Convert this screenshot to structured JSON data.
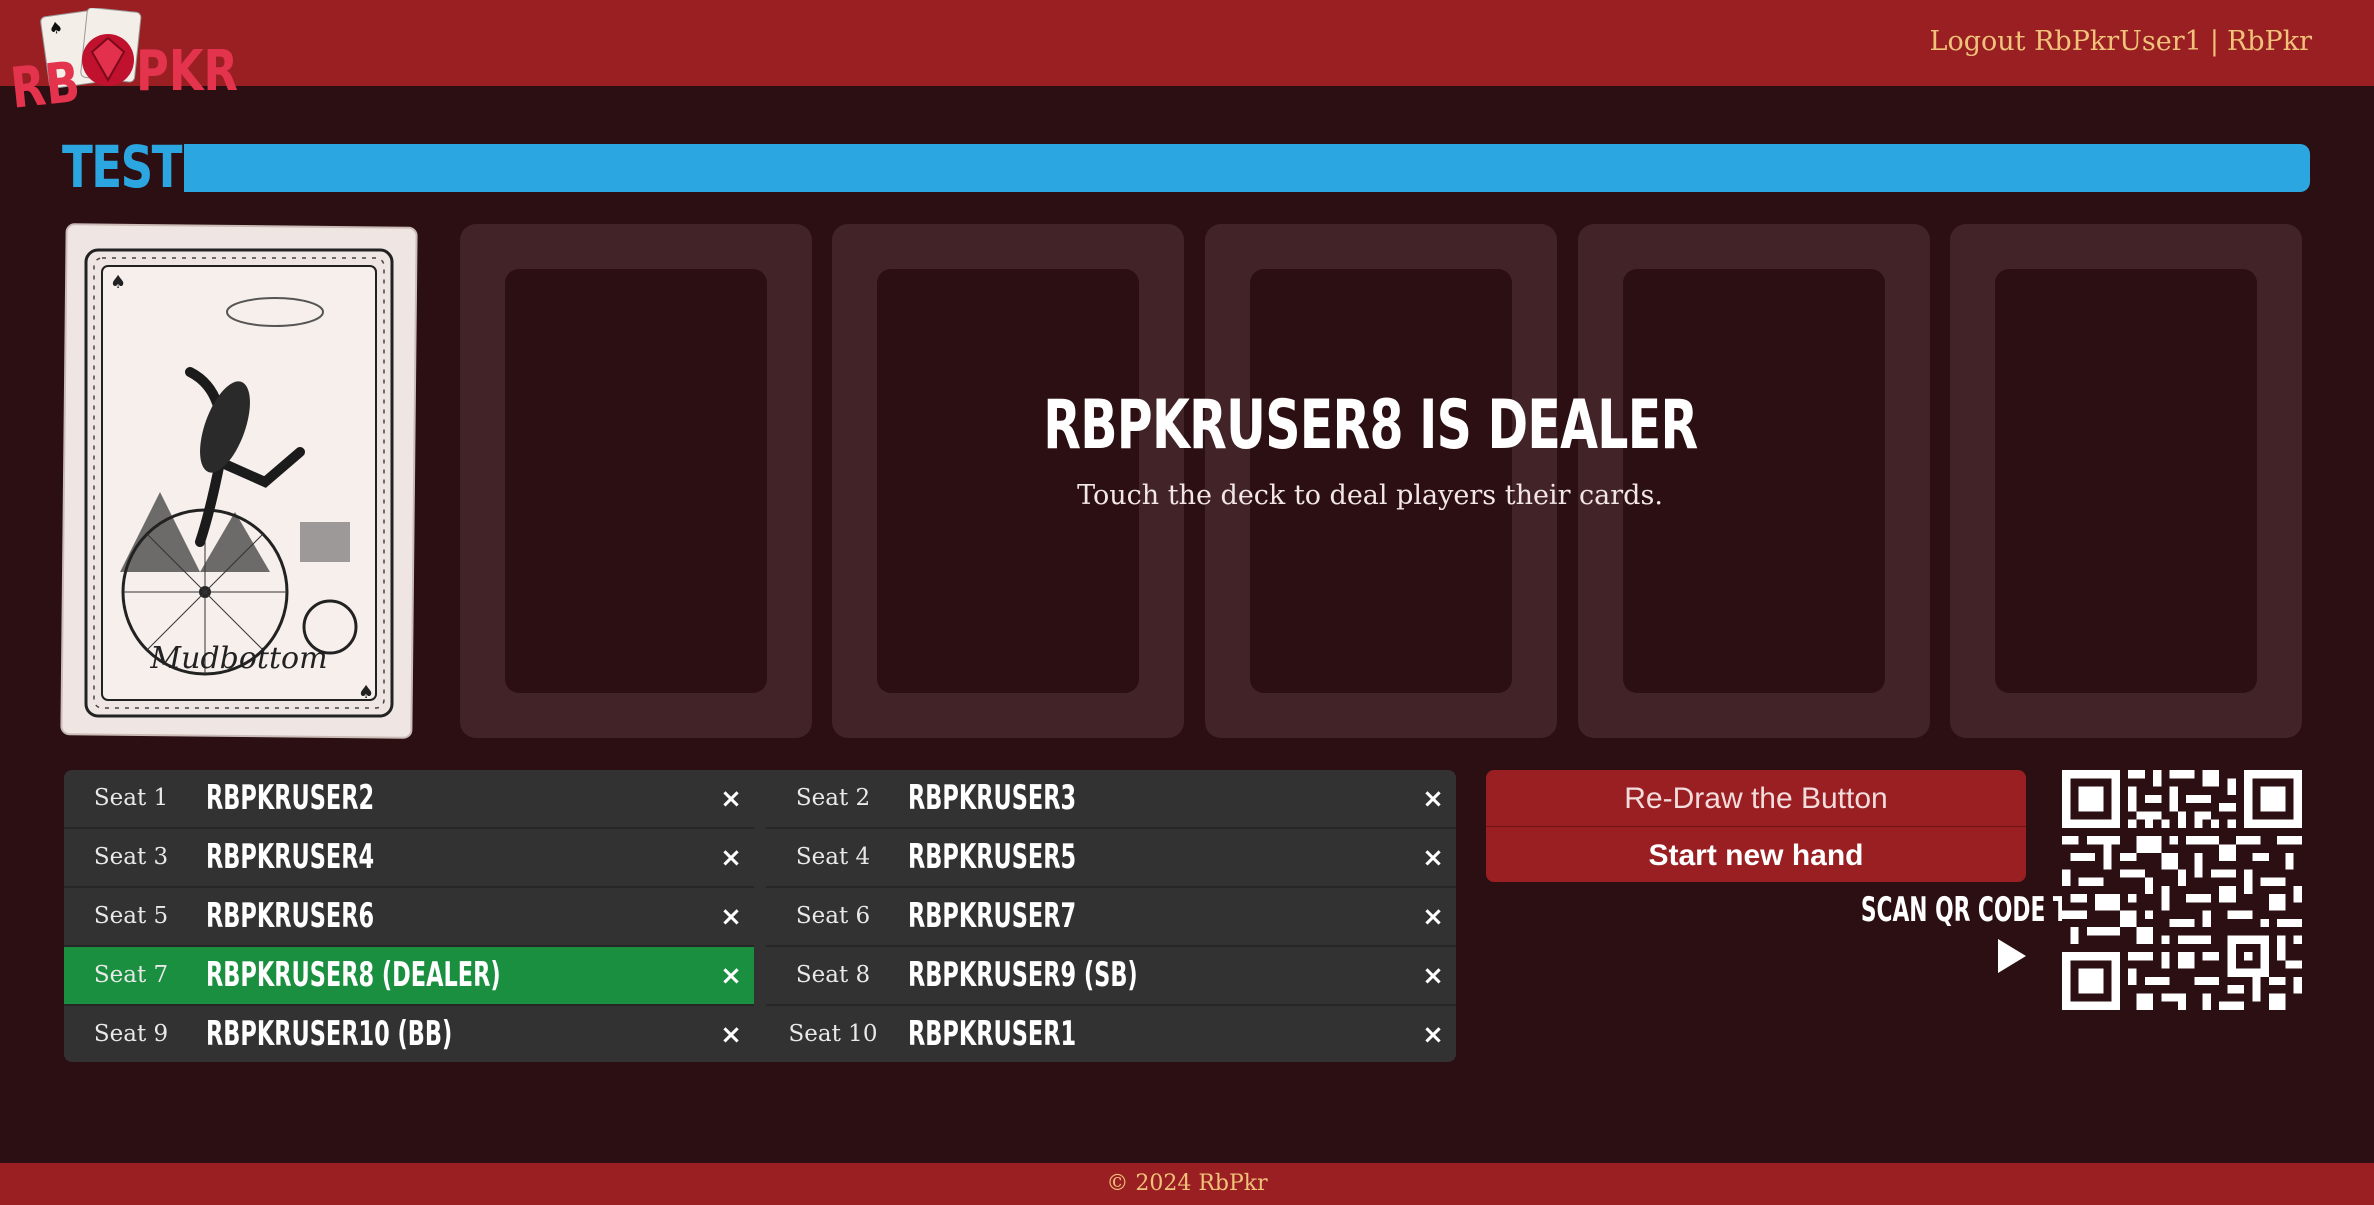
{
  "header": {
    "logo_text": "RBPKR",
    "nav": {
      "logout": "Logout",
      "username": "RbPkrUser1",
      "sep": "|",
      "brand": "RbPkr"
    }
  },
  "table": {
    "name": "TEST"
  },
  "deck": {
    "caption": "Mudbottom"
  },
  "dealer": {
    "title": "RBPKRUSER8 IS DEALER",
    "instruction": "Touch the deck to deal players their cards."
  },
  "seats": [
    {
      "label": "Seat 1",
      "player": "RBPKRUSER2"
    },
    {
      "label": "Seat 2",
      "player": "RBPKRUSER3"
    },
    {
      "label": "Seat 3",
      "player": "RBPKRUSER4"
    },
    {
      "label": "Seat 4",
      "player": "RBPKRUSER5"
    },
    {
      "label": "Seat 5",
      "player": "RBPKRUSER6"
    },
    {
      "label": "Seat 6",
      "player": "RBPKRUSER7"
    },
    {
      "label": "Seat 7",
      "player": "RBPKRUSER8 (DEALER)"
    },
    {
      "label": "Seat 8",
      "player": "RBPKRUSER9 (SB)"
    },
    {
      "label": "Seat 9",
      "player": "RBPKRUSER10 (BB)"
    },
    {
      "label": "Seat 10",
      "player": "RBPKRUSER1"
    }
  ],
  "remove_symbol": "×",
  "actions": {
    "redraw": "Re-Draw the Button",
    "start": "Start new hand",
    "scan": "SCAN QR CODE TO JOIN"
  },
  "footer": {
    "text": "© 2024 RbPkr"
  },
  "colors": {
    "header": "#9a1f22",
    "background": "#2b0f13",
    "accent": "#2ba6e0",
    "dealer_seat": "#1a8f3f",
    "link": "#f0c27a"
  }
}
